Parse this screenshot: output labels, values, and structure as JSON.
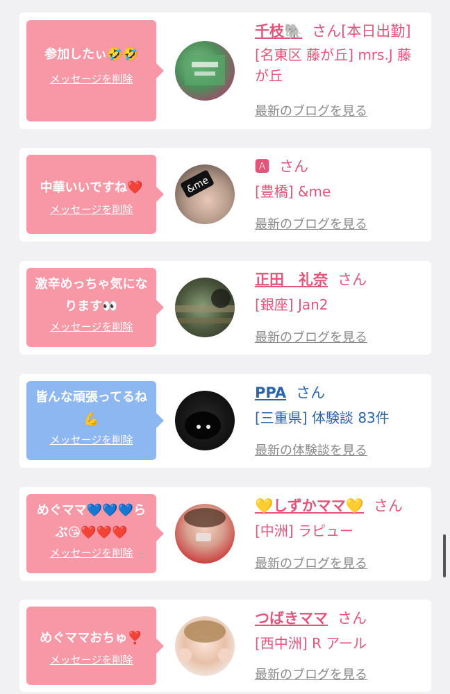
{
  "colors": {
    "pink_bubble": "#f898a6",
    "blue_bubble": "#8db7f0",
    "pink_text": "#e2547a",
    "blue_text": "#2c64a8"
  },
  "delete_label": "メッセージを削除",
  "items": [
    {
      "message": "参加したぃ🤣🤣",
      "name": "千枝🐘",
      "san": "さん[本日出勤]",
      "place": "[名東区 藤が丘] mrs.J 藤が丘",
      "link": "最新のブログを見る",
      "avatar": "avatar-image"
    },
    {
      "message": "中華いいですね❤️",
      "name": "🅰",
      "san": "さん",
      "place": "[豊橋] &me",
      "link": "最新のブログを見る",
      "avatar": "avatar-image",
      "avatar_text": "&me"
    },
    {
      "message": "激辛めっちゃ気になります👀",
      "name": "正田　礼奈",
      "san": "さん",
      "place": "[銀座] Jan2",
      "link": "最新のブログを見る",
      "avatar": "avatar-image"
    },
    {
      "message": "皆んな頑張ってるね💪",
      "name": "PPA",
      "san": "さん",
      "place": "[三重県] 体験談 83件",
      "link": "最新の体験談を見る",
      "avatar": "avatar-image"
    },
    {
      "message": "めぐママ💙💙💙らぶ😘❤️❤️❤️",
      "name": "💛しずかママ💛",
      "san": "さん",
      "place": "[中洲] ラピュー",
      "link": "最新のブログを見る",
      "avatar": "avatar-image"
    },
    {
      "message": "めぐママおちゅ❣️",
      "name": "つばきママ",
      "san": "さん",
      "place": "[西中洲] R アール",
      "link": "最新のブログを見る",
      "avatar": "avatar-image"
    }
  ]
}
